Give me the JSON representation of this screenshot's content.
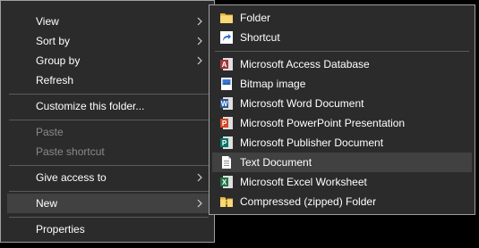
{
  "main_menu": {
    "view": "View",
    "sort_by": "Sort by",
    "group_by": "Group by",
    "refresh": "Refresh",
    "customize": "Customize this folder...",
    "paste": "Paste",
    "paste_shortcut": "Paste shortcut",
    "give_access": "Give access to",
    "new": "New",
    "properties": "Properties"
  },
  "new_submenu": {
    "folder": "Folder",
    "shortcut": "Shortcut",
    "access": "Microsoft Access Database",
    "bitmap": "Bitmap image",
    "word": "Microsoft Word Document",
    "powerpoint": "Microsoft PowerPoint Presentation",
    "publisher": "Microsoft Publisher Document",
    "text": "Text Document",
    "excel": "Microsoft Excel Worksheet",
    "zip": "Compressed (zipped) Folder"
  },
  "colors": {
    "menu_bg": "#2b2b2b",
    "highlight": "#414141",
    "text": "#ffffff",
    "disabled_text": "#8a8a8a",
    "access_red": "#a4373a",
    "word_blue": "#2b579a",
    "powerpoint_orange": "#d24726",
    "publisher_teal": "#077568",
    "excel_green": "#217346",
    "folder_yellow": "#f8d775"
  }
}
